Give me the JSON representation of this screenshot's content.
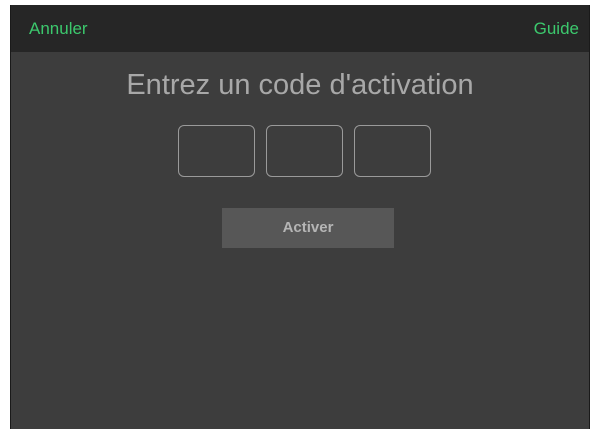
{
  "navbar": {
    "cancel_label": "Annuler",
    "guide_label": "Guide"
  },
  "main": {
    "title": "Entrez un code d'activation",
    "code_fields": [
      {
        "value": ""
      },
      {
        "value": ""
      },
      {
        "value": ""
      }
    ],
    "activate_label": "Activer"
  },
  "colors": {
    "accent": "#3cc86d",
    "background": "#3d3d3d",
    "navbar": "#262626",
    "button": "#575757"
  }
}
